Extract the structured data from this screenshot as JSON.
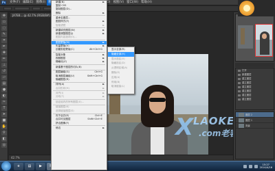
{
  "menubar": {
    "items": [
      "文件(F)",
      "编辑(E)",
      "图像(I)",
      "图层(L)",
      "类型(Y)",
      "选择(S)",
      "滤镜(T)",
      "3D(D)",
      "视图(V)",
      "窗口(W)",
      "帮助(H)"
    ]
  },
  "document": {
    "tab_title": "JA7E8... @ 42.7% (RGB/8#)",
    "status": "42.7%"
  },
  "layer_menu": {
    "items": [
      {
        "label": "新建(N)",
        "arrow": "►",
        "state": "normal"
      },
      {
        "label": "复制 CSS",
        "state": "normal"
      },
      {
        "label": "复制图层(D)...",
        "state": "normal"
      },
      {
        "label": "删除",
        "arrow": "►",
        "state": "normal"
      },
      {
        "sep": true
      },
      {
        "label": "重命名图层...",
        "state": "normal"
      },
      {
        "label": "图层样式(Y)",
        "arrow": "►",
        "state": "normal"
      },
      {
        "label": "智能滤镜",
        "arrow": "►",
        "state": "dis"
      },
      {
        "sep": true
      },
      {
        "label": "新建填充图层(W)",
        "arrow": "►",
        "state": "normal"
      },
      {
        "label": "新建调整图层(J)",
        "arrow": "►",
        "state": "normal"
      },
      {
        "label": "图层内容选项(O)...",
        "state": "dis"
      },
      {
        "sep": true
      },
      {
        "label": "图层蒙版(M)",
        "arrow": "►",
        "state": "hl"
      },
      {
        "label": "矢量蒙版(V)",
        "arrow": "►",
        "state": "normal"
      },
      {
        "label": "创建剪贴蒙版(C)",
        "shortcut": "Alt+Ctrl+G",
        "state": "normal"
      },
      {
        "sep": true
      },
      {
        "label": "智能对象",
        "arrow": "►",
        "state": "normal"
      },
      {
        "label": "视频图层",
        "arrow": "►",
        "state": "normal"
      },
      {
        "label": "栅格化(Z)",
        "arrow": "►",
        "state": "normal"
      },
      {
        "sep": true
      },
      {
        "label": "新建基于图层的切片(B)",
        "state": "normal"
      },
      {
        "sep": true
      },
      {
        "label": "图层编组(G)",
        "shortcut": "Ctrl+G",
        "state": "normal"
      },
      {
        "label": "取消图层编组(U)",
        "shortcut": "Shift+Ctrl+G",
        "state": "normal"
      },
      {
        "label": "隐藏图层(R)",
        "state": "normal"
      },
      {
        "sep": true
      },
      {
        "label": "排列(A)",
        "arrow": "►",
        "state": "normal"
      },
      {
        "label": "合并形状(H)",
        "arrow": "►",
        "state": "dis"
      },
      {
        "sep": true
      },
      {
        "label": "对齐(I)",
        "arrow": "►",
        "state": "dis"
      },
      {
        "label": "分布(T)",
        "arrow": "►",
        "state": "dis"
      },
      {
        "sep": true
      },
      {
        "label": "锁定组内的所有图层(X)...",
        "state": "dis"
      },
      {
        "sep": true
      },
      {
        "label": "链接图层(K)",
        "state": "dis"
      },
      {
        "label": "选择链接图层(S)",
        "state": "dis"
      },
      {
        "sep": true
      },
      {
        "label": "向下合并(E)",
        "shortcut": "Ctrl+E",
        "state": "normal"
      },
      {
        "label": "合并可见图层",
        "shortcut": "Shift+Ctrl+E",
        "state": "normal"
      },
      {
        "label": "拼合图像(F)",
        "state": "normal"
      },
      {
        "sep": true
      },
      {
        "label": "修边",
        "arrow": "►",
        "state": "normal"
      }
    ]
  },
  "mask_submenu": {
    "items": [
      {
        "label": "显示全部(R)",
        "state": "normal"
      },
      {
        "label": "隐藏全部(H)",
        "state": "hl"
      },
      {
        "label": "显示选区(V)",
        "state": "dis"
      },
      {
        "label": "隐藏选区(D)",
        "state": "dis"
      },
      {
        "label": "从透明区域(A)",
        "state": "dis"
      },
      {
        "label": "删除(E)",
        "state": "dis"
      },
      {
        "label": "应用(A)",
        "state": "dis"
      },
      {
        "label": "停用(B)",
        "state": "dis"
      },
      {
        "label": "取消链接(L)",
        "state": "dis"
      }
    ]
  },
  "history": {
    "items": [
      "打开",
      "新建图层",
      "建立图层",
      "建立图层",
      "建立图层",
      "建立图层",
      "建立图层",
      "建立图层"
    ]
  },
  "layers": {
    "items": [
      "图层 2",
      "图层 1",
      "背景"
    ]
  },
  "watermark": {
    "brand": "LAOKE",
    "sub": ".com老客"
  },
  "taskbar": {
    "clock_time": "15:27",
    "clock_date": "2014/4/16"
  }
}
